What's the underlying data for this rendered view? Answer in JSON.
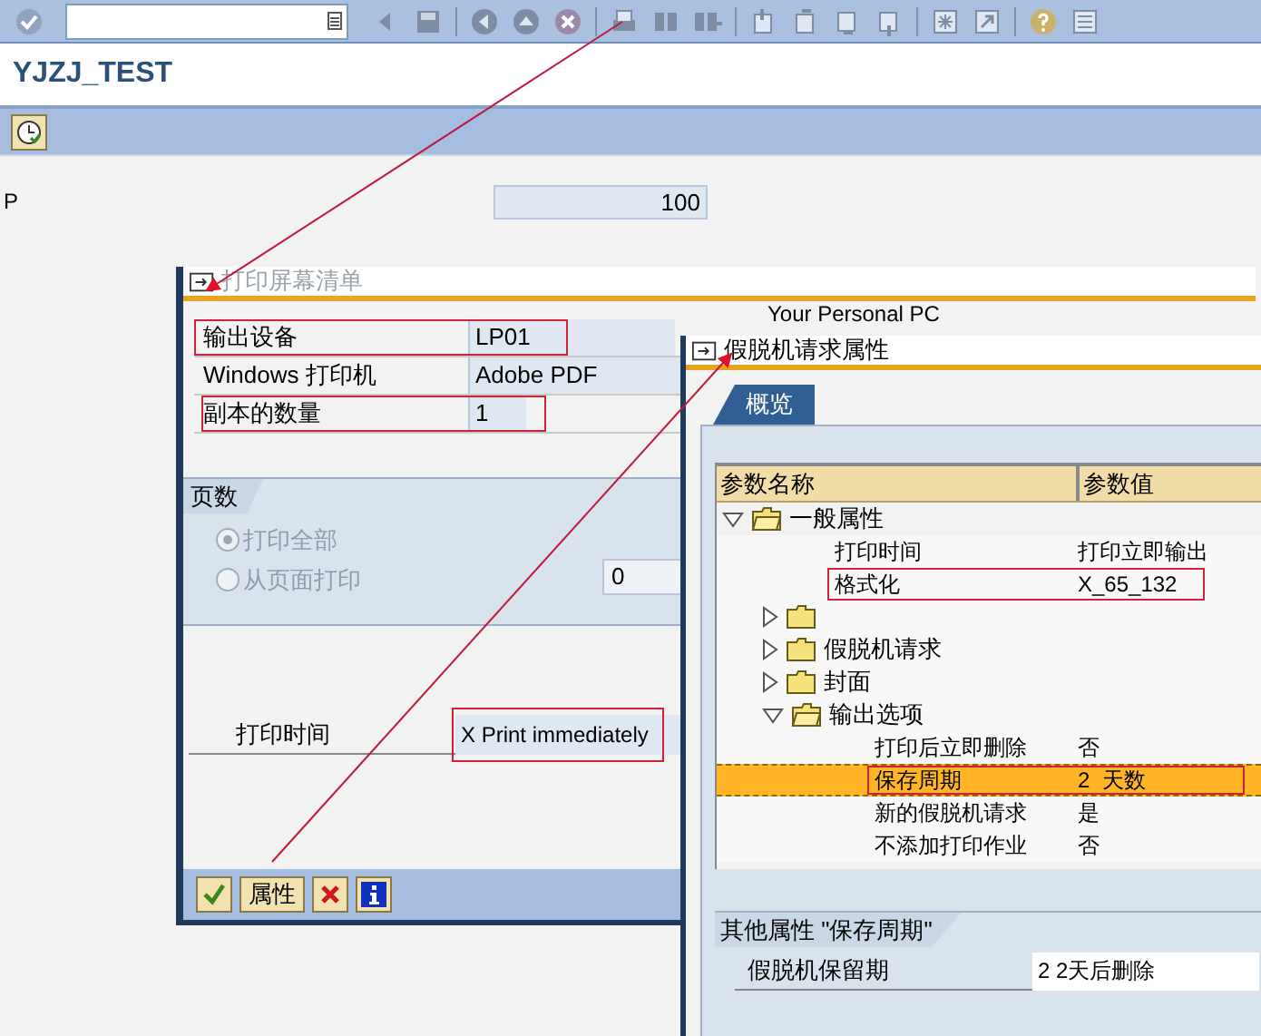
{
  "title": "YJZJ_TEST",
  "selection": {
    "label": "P",
    "value": "100"
  },
  "print_dialog": {
    "title": "打印屏幕清单",
    "note": "Your Personal PC",
    "fields": [
      {
        "label": "输出设备",
        "value": "LP01",
        "highlighted": true
      },
      {
        "label": "Windows 打印机",
        "value": "Adobe PDF",
        "highlighted": false
      },
      {
        "label": "副本的数量",
        "value": "1",
        "highlighted": true
      }
    ],
    "pages_group": {
      "title": "页数",
      "options": [
        {
          "label": "打印全部",
          "selected": true
        },
        {
          "label": "从页面打印",
          "selected": false,
          "value": "0"
        }
      ]
    },
    "print_time": {
      "label": "打印时间",
      "value": "X Print immediately",
      "highlighted": true
    },
    "buttons": [
      {
        "kind": "ok"
      },
      {
        "kind": "text",
        "label": "属性"
      },
      {
        "kind": "cancel"
      },
      {
        "kind": "info"
      }
    ]
  },
  "spool_dialog": {
    "title": "假脱机请求属性",
    "tabs": [
      {
        "label": "概览",
        "selected": true
      }
    ],
    "tree": {
      "columns": [
        "参数名称",
        "参数值"
      ],
      "nodes": [
        {
          "kind": "folder",
          "label": "一般属性",
          "expanded": true,
          "selected": false,
          "children": [
            {
              "kind": "param",
              "name": "打印时间",
              "value": "打印立即输出",
              "selected": false,
              "highlighted": false
            },
            {
              "kind": "param",
              "name": "格式化",
              "value": "X_65_132",
              "selected": false,
              "highlighted": true
            },
            {
              "kind": "folder",
              "expanded": false,
              "selected": false
            },
            {
              "kind": "folder",
              "label": "假脱机请求",
              "expanded": false,
              "selected": false
            },
            {
              "kind": "folder",
              "label": "封面",
              "expanded": false,
              "selected": false
            },
            {
              "kind": "folder",
              "label": "输出选项",
              "expanded": true,
              "selected": false,
              "children": [
                {
                  "kind": "param",
                  "name": "打印后立即删除",
                  "value": "否",
                  "selected": false,
                  "highlighted": false
                },
                {
                  "kind": "param",
                  "name": "保存周期",
                  "value": "2  天数",
                  "selected": true,
                  "highlighted": true
                },
                {
                  "kind": "param",
                  "name": "新的假脱机请求",
                  "value": "是",
                  "selected": false,
                  "highlighted": false
                },
                {
                  "kind": "param",
                  "name": "不添加打印作业",
                  "value": "否",
                  "selected": false,
                  "highlighted": false
                }
              ]
            }
          ]
        }
      ]
    },
    "detail": {
      "title": "其他属性 \"保存周期\"",
      "label": "假脱机保留期",
      "value": "2 2天后删除"
    }
  }
}
